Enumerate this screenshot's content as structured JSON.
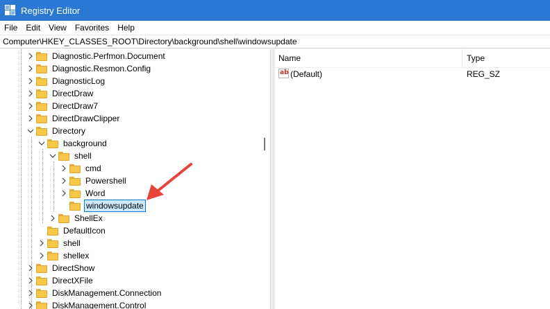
{
  "window": {
    "title": "Registry Editor"
  },
  "menu": [
    "File",
    "Edit",
    "View",
    "Favorites",
    "Help"
  ],
  "address": {
    "path": "Computer\\HKEY_CLASSES_ROOT\\Directory\\background\\shell\\windowsupdate"
  },
  "tree": {
    "items": [
      {
        "label": "Diagnostic.Perfmon.Document",
        "expander": "collapsed",
        "selected": false
      },
      {
        "label": "Diagnostic.Resmon.Config",
        "expander": "collapsed",
        "selected": false
      },
      {
        "label": "DiagnosticLog",
        "expander": "collapsed",
        "selected": false
      },
      {
        "label": "DirectDraw",
        "expander": "collapsed",
        "selected": false
      },
      {
        "label": "DirectDraw7",
        "expander": "collapsed",
        "selected": false
      },
      {
        "label": "DirectDrawClipper",
        "expander": "collapsed",
        "selected": false
      },
      {
        "label": "Directory",
        "expander": "expanded",
        "selected": false
      },
      {
        "label": "background",
        "expander": "expanded",
        "selected": false
      },
      {
        "label": "shell",
        "expander": "expanded",
        "selected": false
      },
      {
        "label": "cmd",
        "expander": "collapsed",
        "selected": false
      },
      {
        "label": "Powershell",
        "expander": "collapsed",
        "selected": false
      },
      {
        "label": "Word",
        "expander": "collapsed",
        "selected": false
      },
      {
        "label": "windowsupdate",
        "expander": "none",
        "selected": true
      },
      {
        "label": "ShellEx",
        "expander": "collapsed",
        "selected": false
      },
      {
        "label": "DefaultIcon",
        "expander": "none",
        "selected": false
      },
      {
        "label": "shell",
        "expander": "collapsed",
        "selected": false
      },
      {
        "label": "shellex",
        "expander": "collapsed",
        "selected": false
      },
      {
        "label": "DirectShow",
        "expander": "collapsed",
        "selected": false
      },
      {
        "label": "DirectXFile",
        "expander": "collapsed",
        "selected": false
      },
      {
        "label": "DiskManagement.Connection",
        "expander": "collapsed",
        "selected": false
      },
      {
        "label": "DiskManagement.Control",
        "expander": "collapsed",
        "selected": false
      }
    ]
  },
  "values_pane": {
    "columns": {
      "name": "Name",
      "type": "Type"
    },
    "rows": [
      {
        "icon": "string-value-icon",
        "icon_text": "ab",
        "name": "(Default)",
        "type": "REG_SZ"
      }
    ]
  },
  "colors": {
    "titlebar": "#2b78d4",
    "selection": "#cce8ff",
    "selection_border": "#0078d7",
    "folder": "#f5c847",
    "annotation_arrow": "#e8433b"
  },
  "icons": {
    "app": "registry-editor-icon",
    "expander_collapsed": "chevron-right-icon",
    "expander_expanded": "chevron-down-icon",
    "folder": "folder-icon",
    "annotation": "red-arrow-icon"
  }
}
